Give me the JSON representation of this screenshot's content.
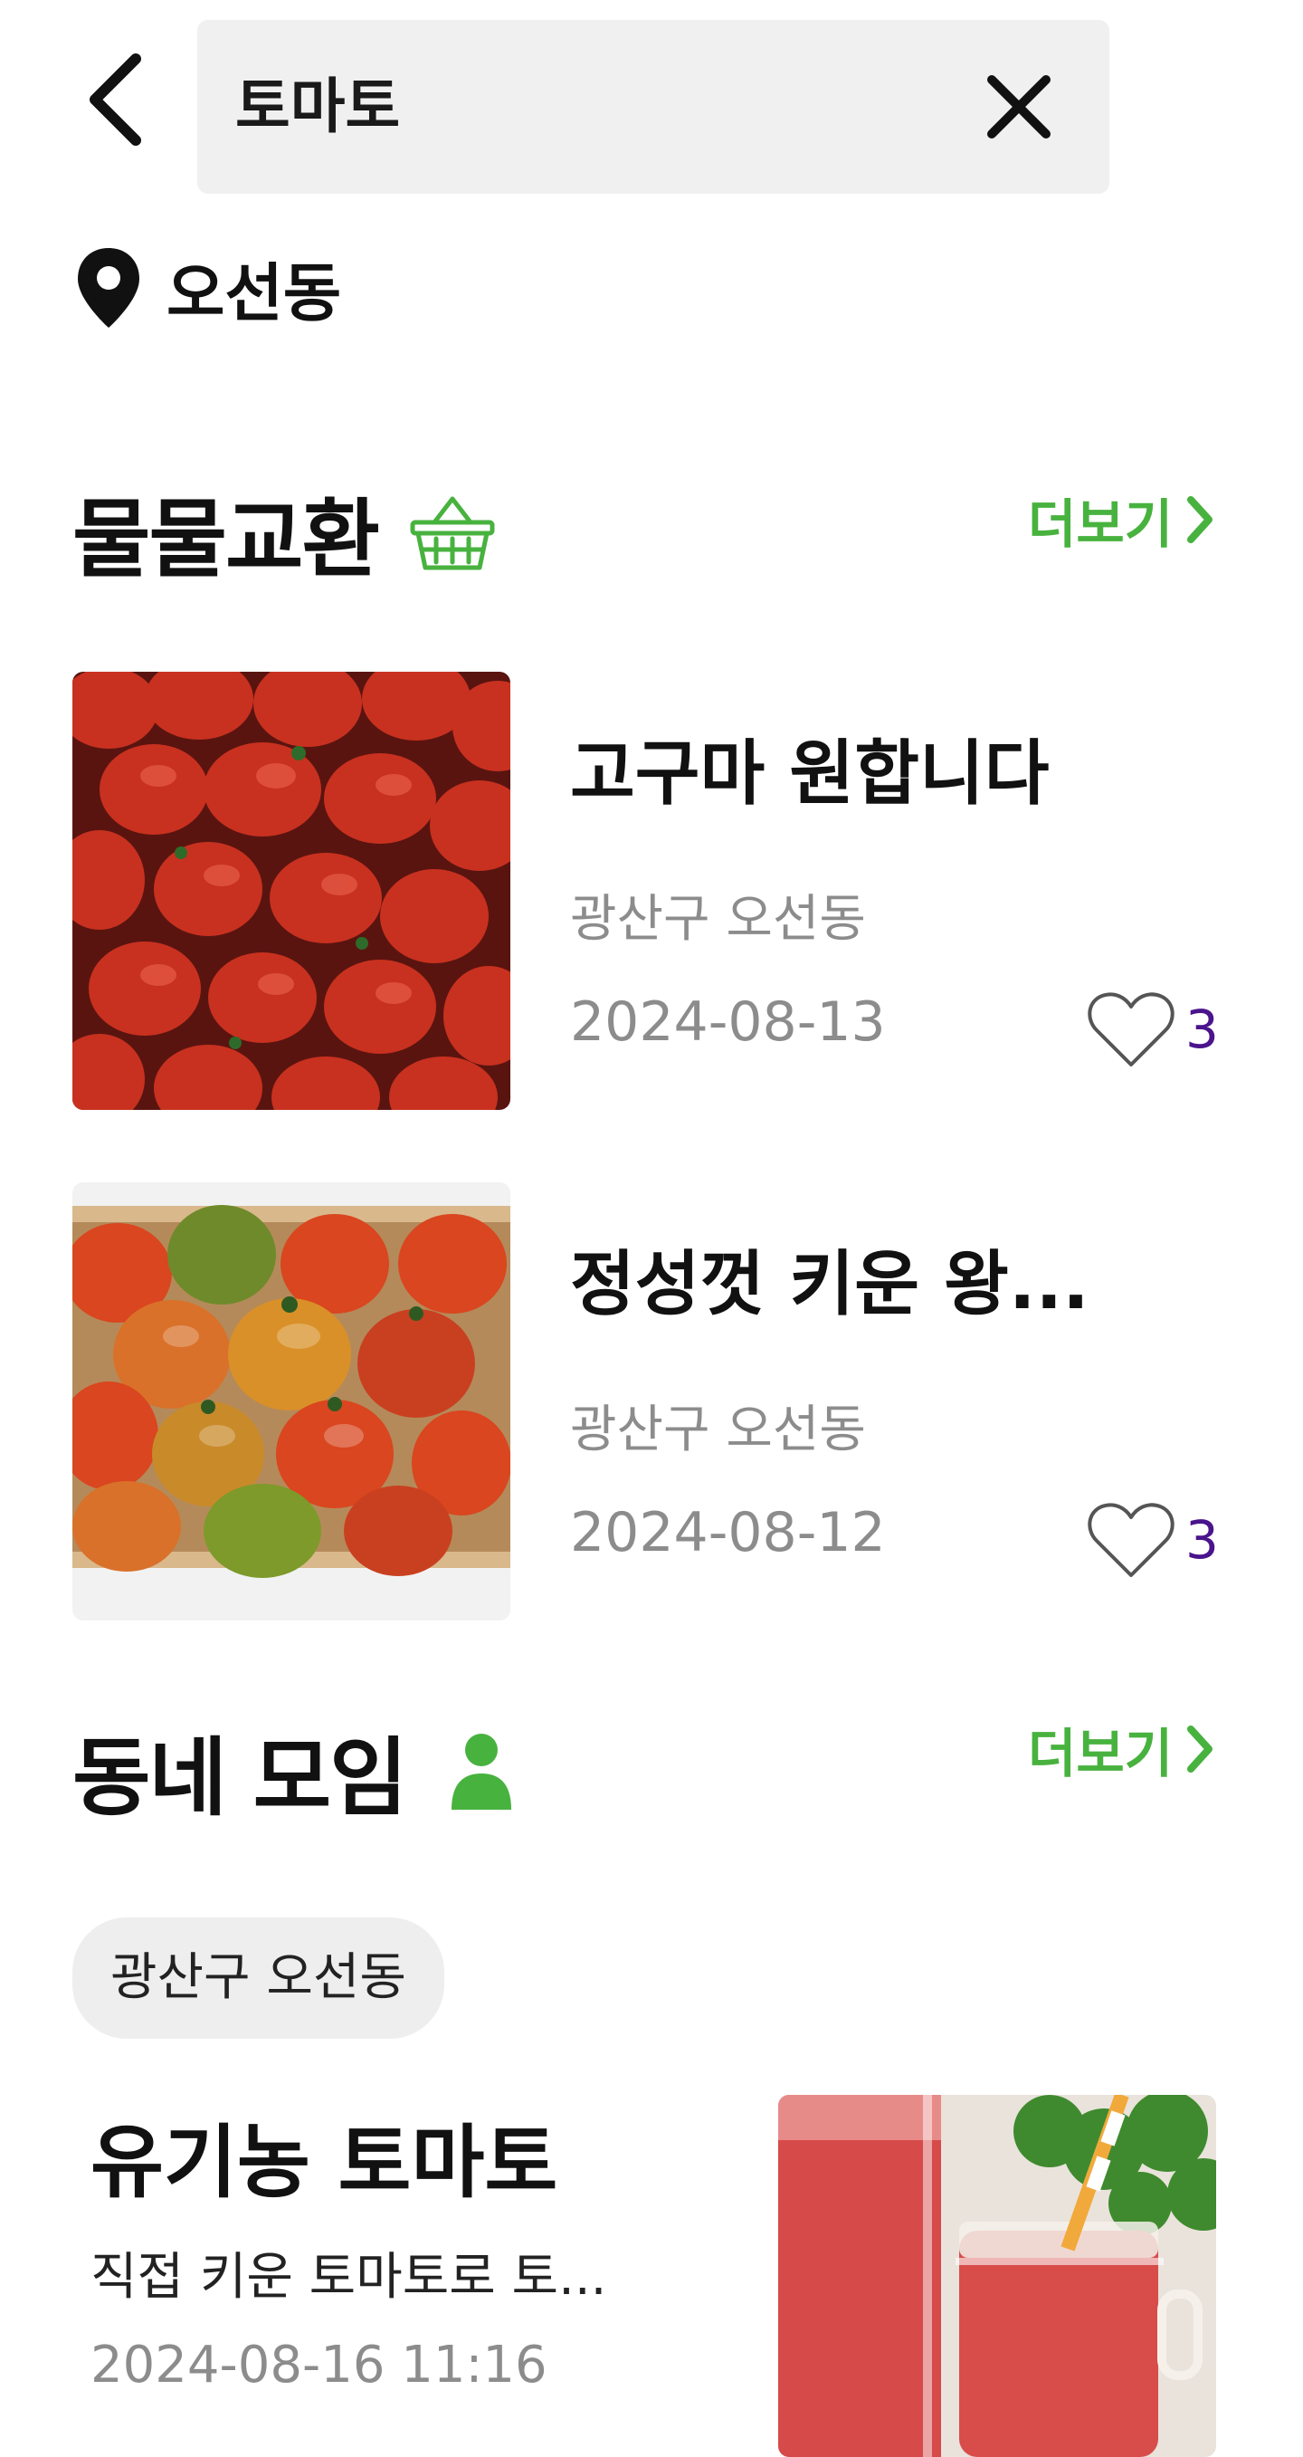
{
  "search": {
    "query": "토마토"
  },
  "location": {
    "name": "오선동"
  },
  "trade_section": {
    "title": "물물교환",
    "more_label": "더보기",
    "items": [
      {
        "title": "고구마 원합니다",
        "location": "광산구 오선동",
        "date": "2024-08-13",
        "likes": "3"
      },
      {
        "title": "정성껏 키운 왕...",
        "location": "광산구 오선동",
        "date": "2024-08-12",
        "likes": "3"
      }
    ]
  },
  "meeting_section": {
    "title": "동네 모임",
    "more_label": "더보기",
    "chip": "광산구 오선동",
    "post": {
      "title": "유기농 토마토",
      "description": "직접 키운 토마토로 토...",
      "date": "2024-08-16 11:16"
    }
  },
  "colors": {
    "accent_green": "#48b23f",
    "like_count": "#4a148c",
    "muted_text": "#8c8c8c"
  },
  "icons": [
    "back-arrow-icon",
    "close-icon",
    "location-pin-icon",
    "basket-icon",
    "chevron-right-icon",
    "heart-icon",
    "person-icon"
  ]
}
